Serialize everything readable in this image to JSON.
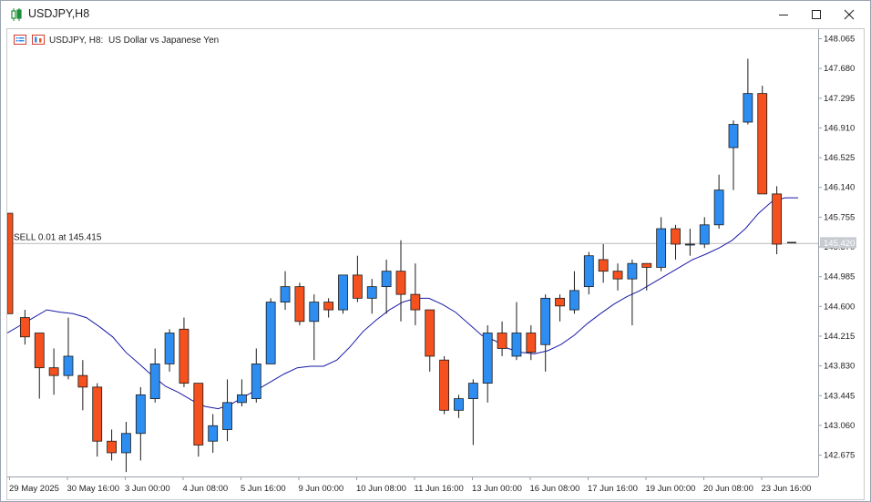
{
  "window": {
    "title": "USDJPY,H8"
  },
  "chart_header": {
    "symbol": "USDJPY, H8:",
    "description": "US Dollar vs Japanese Yen"
  },
  "trade_line": {
    "label": "SELL 0.01 at 145.415",
    "price": 145.415
  },
  "current_price": {
    "label": "145.420",
    "price": 145.42
  },
  "colors": {
    "bull": "#2e8df0",
    "bear": "#f4511e",
    "ma": "#1a1aa6",
    "trade_line": "#b9b9b9",
    "price_badge": "#c8ccd1"
  },
  "chart_data": {
    "type": "candlestick",
    "symbol": "USDJPY",
    "timeframe": "H8",
    "ylim": [
      142.3,
      148.2
    ],
    "y_ticks": [
      "148.065",
      "147.680",
      "147.295",
      "146.910",
      "146.525",
      "146.140",
      "145.755",
      "145.370",
      "144.985",
      "144.600",
      "144.215",
      "143.830",
      "143.445",
      "143.060",
      "142.675"
    ],
    "x_labels": [
      "29 May 2025",
      "30 May 16:00",
      "3 Jun 00:00",
      "4 Jun 08:00",
      "5 Jun 16:00",
      "9 Jun 00:00",
      "10 Jun 08:00",
      "11 Jun 16:00",
      "13 Jun 00:00",
      "16 Jun 08:00",
      "17 Jun 16:00",
      "19 Jun 00:00",
      "20 Jun 08:00",
      "23 Jun 16:00"
    ],
    "candles": [
      {
        "o": 145.8,
        "h": 145.8,
        "l": 144.5,
        "c": 144.5
      },
      {
        "o": 144.45,
        "h": 144.55,
        "l": 144.1,
        "c": 144.2
      },
      {
        "o": 144.25,
        "h": 144.25,
        "l": 143.4,
        "c": 143.8
      },
      {
        "o": 143.8,
        "h": 144.05,
        "l": 143.45,
        "c": 143.7
      },
      {
        "o": 143.7,
        "h": 144.45,
        "l": 143.65,
        "c": 143.95
      },
      {
        "o": 143.7,
        "h": 143.9,
        "l": 143.25,
        "c": 143.55
      },
      {
        "o": 143.55,
        "h": 143.6,
        "l": 142.65,
        "c": 142.85
      },
      {
        "o": 142.85,
        "h": 143.0,
        "l": 142.6,
        "c": 142.7
      },
      {
        "o": 142.7,
        "h": 143.1,
        "l": 142.45,
        "c": 142.95
      },
      {
        "o": 142.95,
        "h": 143.55,
        "l": 142.6,
        "c": 143.45
      },
      {
        "o": 143.4,
        "h": 144.05,
        "l": 143.35,
        "c": 143.85
      },
      {
        "o": 143.85,
        "h": 144.3,
        "l": 143.75,
        "c": 144.25
      },
      {
        "o": 144.3,
        "h": 144.45,
        "l": 143.55,
        "c": 143.6
      },
      {
        "o": 143.6,
        "h": 143.6,
        "l": 142.65,
        "c": 142.8
      },
      {
        "o": 142.85,
        "h": 143.2,
        "l": 142.7,
        "c": 143.05
      },
      {
        "o": 143.0,
        "h": 143.65,
        "l": 142.85,
        "c": 143.35
      },
      {
        "o": 143.35,
        "h": 143.65,
        "l": 143.3,
        "c": 143.45
      },
      {
        "o": 143.4,
        "h": 144.05,
        "l": 143.35,
        "c": 143.85
      },
      {
        "o": 143.85,
        "h": 144.7,
        "l": 143.85,
        "c": 144.65
      },
      {
        "o": 144.65,
        "h": 145.05,
        "l": 144.55,
        "c": 144.85
      },
      {
        "o": 144.85,
        "h": 144.9,
        "l": 144.35,
        "c": 144.4
      },
      {
        "o": 144.4,
        "h": 144.75,
        "l": 143.9,
        "c": 144.65
      },
      {
        "o": 144.65,
        "h": 144.7,
        "l": 144.45,
        "c": 144.55
      },
      {
        "o": 144.55,
        "h": 145.0,
        "l": 144.5,
        "c": 145.0
      },
      {
        "o": 145.0,
        "h": 145.25,
        "l": 144.65,
        "c": 144.7
      },
      {
        "o": 144.7,
        "h": 144.95,
        "l": 144.5,
        "c": 144.85
      },
      {
        "o": 144.85,
        "h": 145.2,
        "l": 144.5,
        "c": 145.05
      },
      {
        "o": 145.05,
        "h": 145.45,
        "l": 144.4,
        "c": 144.75
      },
      {
        "o": 144.75,
        "h": 145.15,
        "l": 144.35,
        "c": 144.55
      },
      {
        "o": 144.55,
        "h": 144.55,
        "l": 143.75,
        "c": 143.95
      },
      {
        "o": 143.9,
        "h": 143.95,
        "l": 143.2,
        "c": 143.25
      },
      {
        "o": 143.25,
        "h": 143.45,
        "l": 143.15,
        "c": 143.4
      },
      {
        "o": 143.4,
        "h": 143.65,
        "l": 142.8,
        "c": 143.6
      },
      {
        "o": 143.6,
        "h": 144.35,
        "l": 143.35,
        "c": 144.25
      },
      {
        "o": 144.25,
        "h": 144.4,
        "l": 143.95,
        "c": 144.05
      },
      {
        "o": 143.95,
        "h": 144.65,
        "l": 143.9,
        "c": 144.25
      },
      {
        "o": 144.25,
        "h": 144.35,
        "l": 143.9,
        "c": 144.0
      },
      {
        "o": 144.1,
        "h": 144.75,
        "l": 143.75,
        "c": 144.7
      },
      {
        "o": 144.7,
        "h": 144.75,
        "l": 144.4,
        "c": 144.6
      },
      {
        "o": 144.55,
        "h": 145.05,
        "l": 144.5,
        "c": 144.8
      },
      {
        "o": 144.85,
        "h": 145.3,
        "l": 144.75,
        "c": 145.25
      },
      {
        "o": 145.2,
        "h": 145.4,
        "l": 144.9,
        "c": 145.05
      },
      {
        "o": 145.05,
        "h": 145.15,
        "l": 144.8,
        "c": 144.95
      },
      {
        "o": 144.95,
        "h": 145.2,
        "l": 144.35,
        "c": 145.15
      },
      {
        "o": 145.15,
        "h": 145.15,
        "l": 144.8,
        "c": 145.1
      },
      {
        "o": 145.1,
        "h": 145.75,
        "l": 145.05,
        "c": 145.6
      },
      {
        "o": 145.6,
        "h": 145.65,
        "l": 145.2,
        "c": 145.4
      },
      {
        "o": 145.4,
        "h": 145.6,
        "l": 145.25,
        "c": 145.4
      },
      {
        "o": 145.4,
        "h": 145.75,
        "l": 145.35,
        "c": 145.65
      },
      {
        "o": 145.65,
        "h": 146.3,
        "l": 145.6,
        "c": 146.1
      },
      {
        "o": 146.65,
        "h": 147.0,
        "l": 146.1,
        "c": 146.95
      },
      {
        "o": 146.98,
        "h": 147.8,
        "l": 146.95,
        "c": 147.35
      },
      {
        "o": 147.35,
        "h": 147.45,
        "l": 146.05,
        "c": 146.05
      },
      {
        "o": 146.05,
        "h": 146.15,
        "l": 145.27,
        "c": 145.4
      },
      {
        "o": 145.42,
        "h": 145.42,
        "l": 145.42,
        "c": 145.42
      }
    ],
    "ma": [
      144.25,
      144.35,
      144.45,
      144.55,
      144.52,
      144.5,
      144.45,
      144.33,
      144.2,
      144.0,
      143.85,
      143.7,
      143.56,
      143.48,
      143.38,
      143.3,
      143.27,
      143.33,
      143.43,
      143.52,
      143.62,
      143.72,
      143.8,
      143.82,
      143.82,
      143.9,
      144.07,
      144.27,
      144.42,
      144.55,
      144.65,
      144.7,
      144.7,
      144.62,
      144.52,
      144.37,
      144.22,
      144.15,
      144.05,
      144.0,
      143.98,
      144.02,
      144.1,
      144.22,
      144.37,
      144.5,
      144.62,
      144.72,
      144.8,
      144.9,
      145.0,
      145.1,
      145.2,
      145.27,
      145.35,
      145.45,
      145.6,
      145.8,
      145.95,
      146.0,
      146.0
    ]
  }
}
